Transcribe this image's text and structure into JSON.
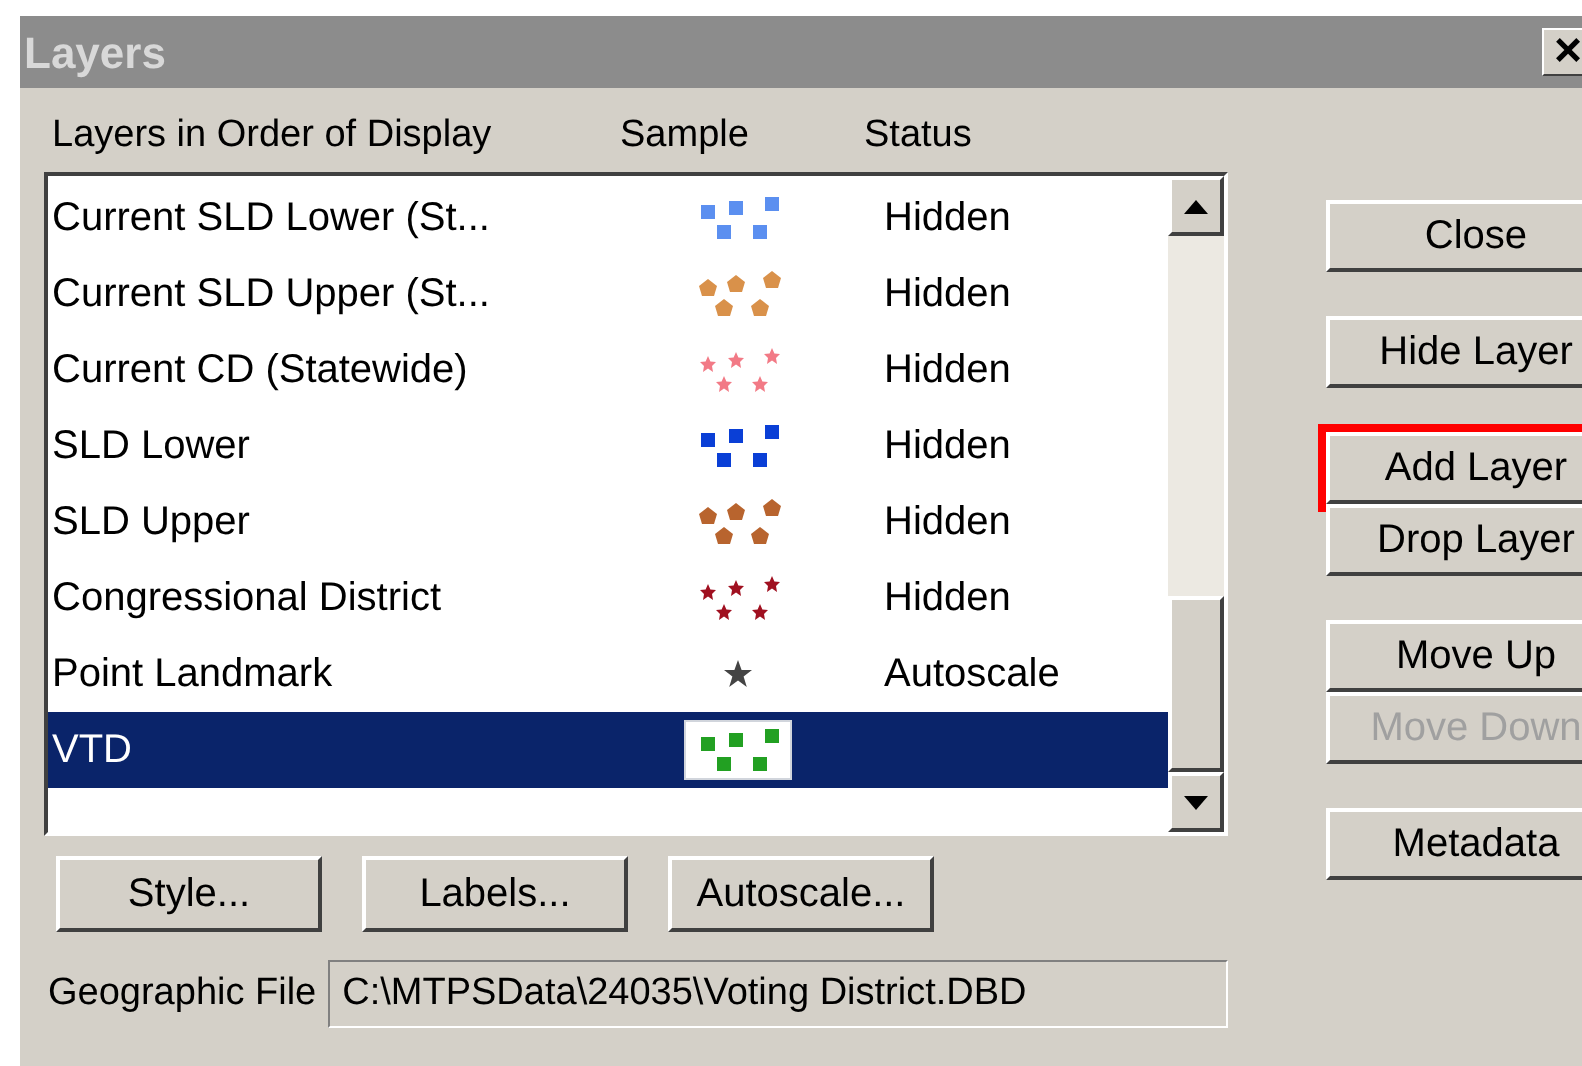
{
  "window": {
    "title": "Layers",
    "close_glyph": "×"
  },
  "columns": [
    "Layers in Order of Display",
    "Sample",
    "Status"
  ],
  "layers": [
    {
      "name": "Current SLD Lower (St...",
      "kind": "squares",
      "color": "#5b8ff0",
      "status": "Hidden",
      "selected": false
    },
    {
      "name": "Current SLD Upper (St...",
      "kind": "pentagons",
      "color": "#d9914a",
      "status": "Hidden",
      "selected": false
    },
    {
      "name": "Current CD (Statewide)",
      "kind": "stars",
      "color": "#f27a86",
      "status": "Hidden",
      "selected": false
    },
    {
      "name": "SLD Lower",
      "kind": "squares",
      "color": "#0a3fd6",
      "status": "Hidden",
      "selected": false
    },
    {
      "name": "SLD Upper",
      "kind": "pentagons",
      "color": "#b8642e",
      "status": "Hidden",
      "selected": false
    },
    {
      "name": "Congressional District",
      "kind": "stars",
      "color": "#a01020",
      "status": "Hidden",
      "selected": false
    },
    {
      "name": "Point Landmark",
      "kind": "star",
      "color": "#444444",
      "status": "Autoscale",
      "selected": false
    },
    {
      "name": "VTD",
      "kind": "squares",
      "color": "#22a022",
      "selected": true
    }
  ],
  "side_button_groups": [
    [
      {
        "label": "Close",
        "disabled": false,
        "highlighted": false
      }
    ],
    [
      {
        "label": "Hide Layer",
        "disabled": false,
        "highlighted": false
      }
    ],
    [
      {
        "label": "Add Layer",
        "disabled": false,
        "highlighted": true
      },
      {
        "label": "Drop Layer",
        "disabled": false,
        "highlighted": false
      }
    ],
    [
      {
        "label": "Move Up",
        "disabled": false,
        "highlighted": false
      },
      {
        "label": "Move Down",
        "disabled": true,
        "highlighted": false
      }
    ],
    [
      {
        "label": "Metadata",
        "disabled": false,
        "highlighted": false
      }
    ]
  ],
  "bottom_buttons": [
    "Style...",
    "Labels...",
    "Autoscale..."
  ],
  "geographic_file": {
    "label": "Geographic File",
    "value": "C:\\MTPSData\\24035\\Voting District.DBD"
  }
}
